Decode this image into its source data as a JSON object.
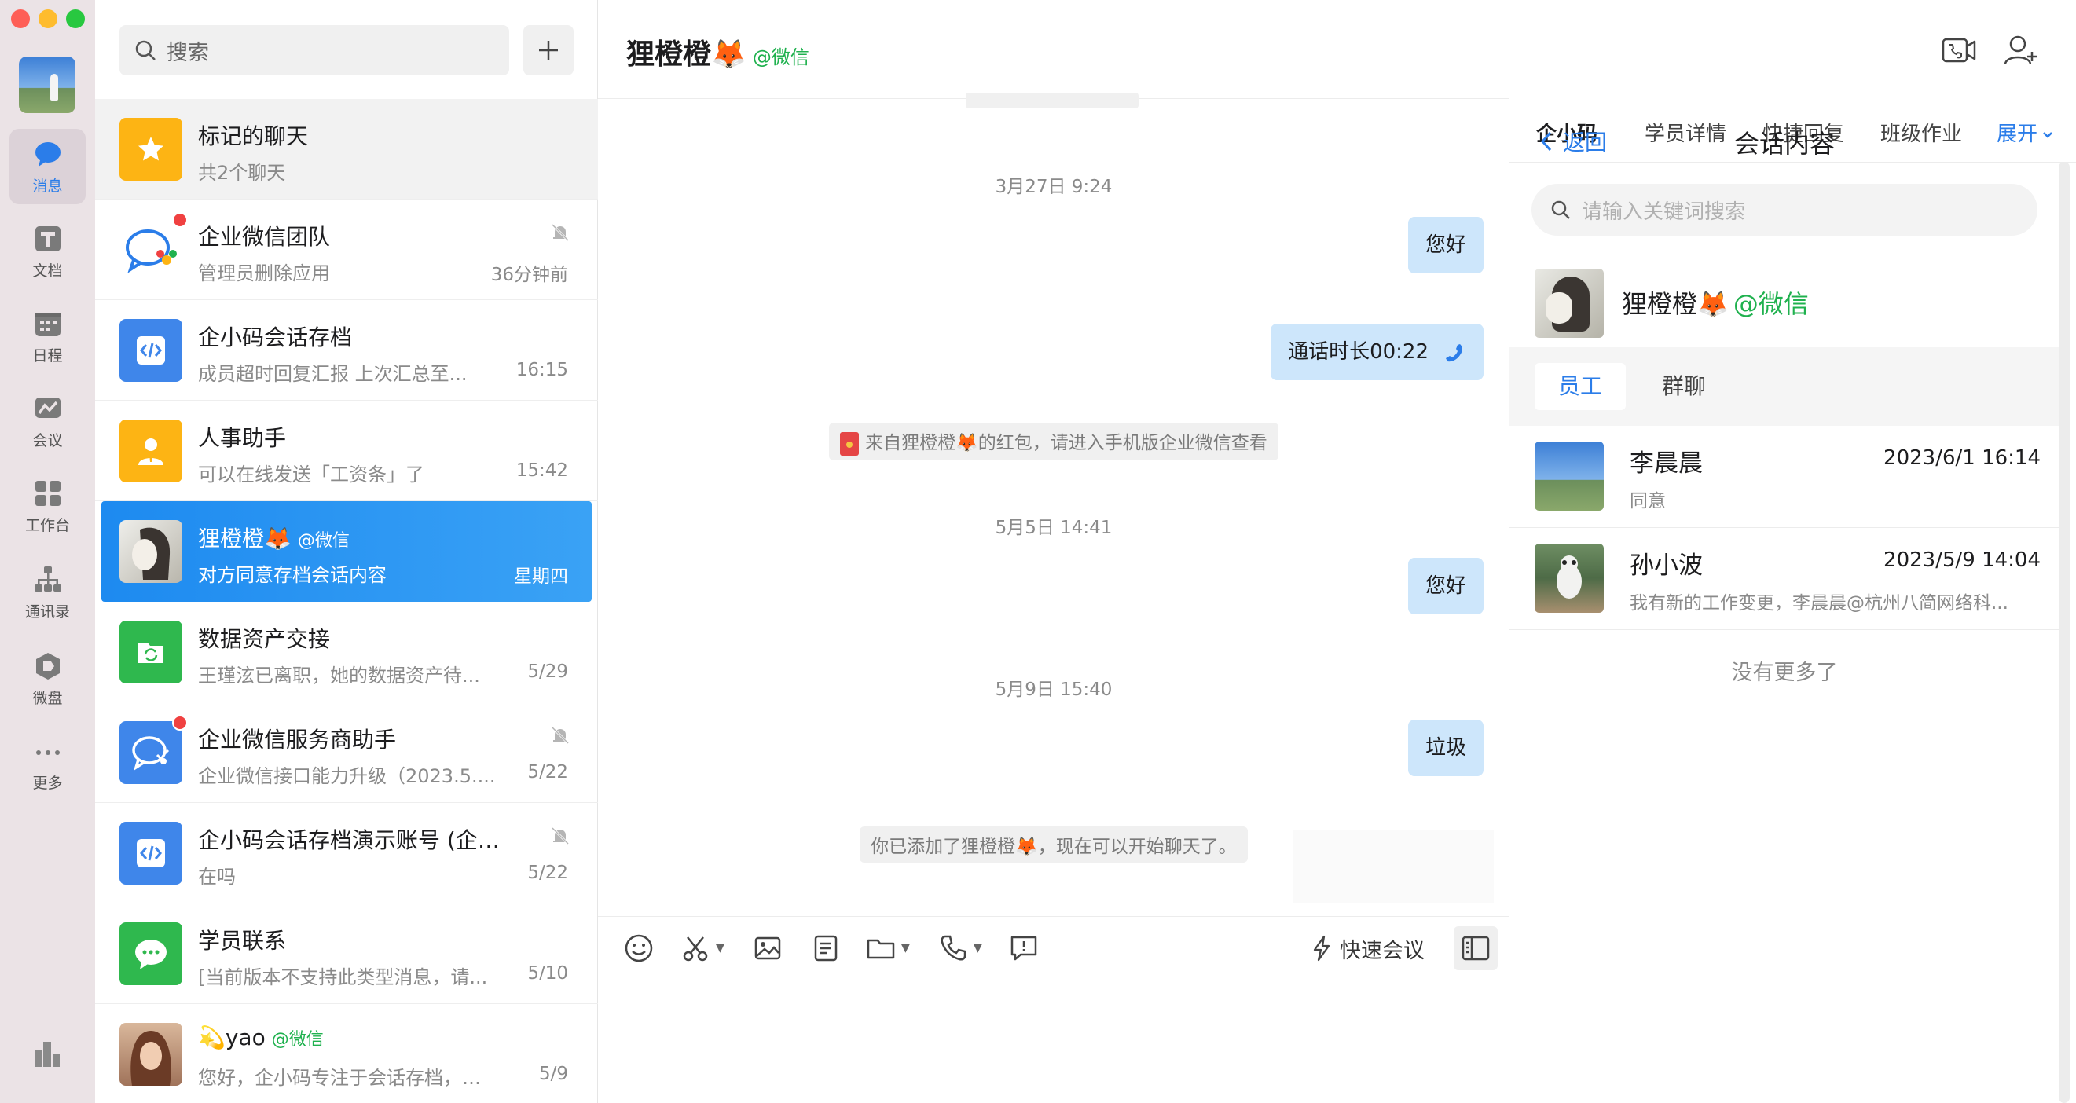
{
  "nav": {
    "items": [
      {
        "label": "消息",
        "icon": "message-icon",
        "active": true
      },
      {
        "label": "文档",
        "icon": "document-icon"
      },
      {
        "label": "日程",
        "icon": "calendar-icon"
      },
      {
        "label": "会议",
        "icon": "meeting-icon"
      },
      {
        "label": "工作台",
        "icon": "workbench-icon"
      },
      {
        "label": "通讯录",
        "icon": "contacts-icon"
      },
      {
        "label": "微盘",
        "icon": "drive-icon"
      },
      {
        "label": "更多",
        "icon": "more-icon"
      }
    ]
  },
  "conversations": {
    "search_placeholder": "搜索",
    "items": [
      {
        "name": "标记的聊天",
        "sub": "共2个聊天",
        "time": ""
      },
      {
        "name": "企业微信团队",
        "sub": "管理员删除应用",
        "time": "36分钟前"
      },
      {
        "name": "企小码会话存档",
        "sub": "成员超时回复汇报 上次汇总至...",
        "time": "16:15"
      },
      {
        "name": "人事助手",
        "sub": "可以在线发送「工资条」了",
        "time": "15:42"
      },
      {
        "name": "狸橙橙🦊",
        "tag": "@微信",
        "sub": "对方同意存档会话内容",
        "time": "星期四"
      },
      {
        "name": "数据资产交接",
        "sub": "王瑾泫已离职，她的数据资产待...",
        "time": "5/29"
      },
      {
        "name": "企业微信服务商助手",
        "sub": "企业微信接口能力升级（2023.5....",
        "time": "5/22"
      },
      {
        "name": "企小码会话存档演示账号 (企小...",
        "sub": "在吗",
        "time": "5/22"
      },
      {
        "name": "学员联系",
        "sub": "[当前版本不支持此类型消息，请...",
        "time": "5/10"
      },
      {
        "name": "💫yao",
        "tag": "@微信",
        "sub": "您好，企小码专注于会话存档，此...",
        "time": "5/9"
      }
    ]
  },
  "chat": {
    "title": "狸橙橙🦊",
    "title_tag": "@微信",
    "messages": {
      "ts1": "3月27日 9:24",
      "m1": "您好",
      "m2": "通话时长00:22",
      "sys1": "来自狸橙橙🦊的红包，请进入手机版企业微信查看",
      "ts2": "5月5日 14:41",
      "m3": "您好",
      "ts3": "5月9日 15:40",
      "m4": "垃圾",
      "sys2": "你已添加了狸橙橙🦊，现在可以开始聊天了。"
    },
    "toolbar": {
      "quick_meeting": "快速会议"
    }
  },
  "side": {
    "tabs": [
      "企小码",
      "学员详情",
      "快捷回复",
      "班级作业"
    ],
    "expand": "展开",
    "back": "返回",
    "title": "会话内容",
    "search_placeholder": "请输入关键词搜索",
    "contact": {
      "name": "狸橙橙🦊",
      "tag": "@微信"
    },
    "segments": [
      "员工",
      "群聊"
    ],
    "records": [
      {
        "name": "李晨晨",
        "time": "2023/6/1 16:14",
        "msg": "同意"
      },
      {
        "name": "孙小波",
        "time": "2023/5/9 14:04",
        "msg": "我有新的工作变更，李晨晨@杭州八简网络科..."
      }
    ],
    "no_more": "没有更多了"
  },
  "colors": {
    "accent": "#2b7de9",
    "selected": "#1d8af0",
    "bubble": "#cde6fb",
    "wechat_green": "#1fb14e",
    "rail_bg": "#ebe3e6"
  }
}
